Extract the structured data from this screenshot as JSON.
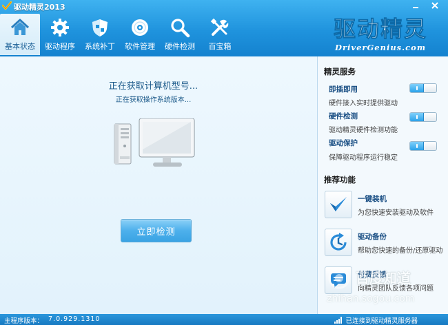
{
  "window": {
    "title": "驱动精灵2013",
    "logo_icon": "app-logo-icon",
    "controls": [
      "minimize-icon",
      "close-icon"
    ]
  },
  "toolbar": {
    "tabs": [
      {
        "label": "基本状态",
        "icon": "home-icon",
        "active": true
      },
      {
        "label": "驱动程序",
        "icon": "gear-icon",
        "active": false
      },
      {
        "label": "系统补丁",
        "icon": "shield-icon",
        "active": false
      },
      {
        "label": "软件管理",
        "icon": "disc-icon",
        "active": false
      },
      {
        "label": "硬件检测",
        "icon": "magnifier-icon",
        "active": false
      },
      {
        "label": "百宝箱",
        "icon": "tools-icon",
        "active": false
      }
    ]
  },
  "brand": {
    "logo_text": "驱动精灵",
    "sub": "DriverGenius.com"
  },
  "main": {
    "status_main": "正在获取计算机型号...",
    "status_sub": "正在获取操作系统版本...",
    "detect_button": "立即检测"
  },
  "side": {
    "services_heading": "精灵服务",
    "services": [
      {
        "name": "即插即用",
        "desc": "硬件接入实时提供驱动",
        "enabled": true
      },
      {
        "name": "硬件检测",
        "desc": "驱动精灵硬件检测功能",
        "enabled": true
      },
      {
        "name": "驱动保护",
        "desc": "保障驱动程序运行稳定",
        "enabled": true
      }
    ],
    "features_heading": "推荐功能",
    "features": [
      {
        "name": "一键装机",
        "desc": "为您快速安装驱动及软件",
        "icon": "checkmark-icon"
      },
      {
        "name": "驱动备份",
        "desc": "帮助您快速的备份/还原驱动",
        "icon": "backup-icon"
      },
      {
        "name": "付费反馈",
        "desc": "向精灵团队反馈各项问题",
        "icon": "feedback-icon"
      }
    ]
  },
  "statusbar": {
    "version_label": "主程序版本：",
    "version_value": "7.0.929.1310",
    "connection": "已连接到驱动精灵服务器"
  },
  "watermark": {
    "text": "百度知道",
    "url": "zhihan.sogou.com"
  },
  "colors": {
    "accent": "#1f93dd",
    "toolbar_active": "#eaf6fd",
    "button": "#4db0ec"
  }
}
